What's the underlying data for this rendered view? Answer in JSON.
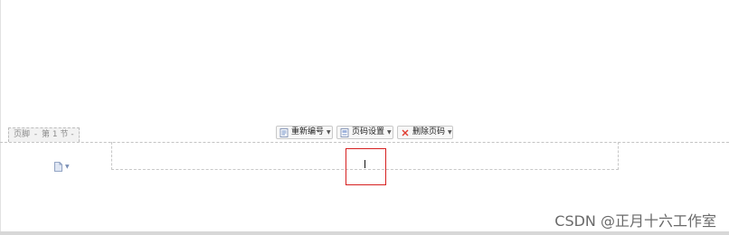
{
  "footer_tab": {
    "label": "页脚",
    "separator": "-",
    "section": "第 1 节",
    "trailing": "-"
  },
  "toolbar": {
    "renumber_label": "重新编号",
    "page_settings_label": "页码设置",
    "delete_page_number_label": "删除页码"
  },
  "icons": {
    "renumber": "renumber-icon",
    "page_settings": "page-settings-icon",
    "delete": "delete-x-icon",
    "page_number_insert": "page-icon"
  },
  "colors": {
    "highlight_border": "#d62020",
    "delete_icon": "#e03c31",
    "icon_blue": "#4a6fb5"
  },
  "watermark": {
    "text": "CSDN @正月十六工作室"
  }
}
